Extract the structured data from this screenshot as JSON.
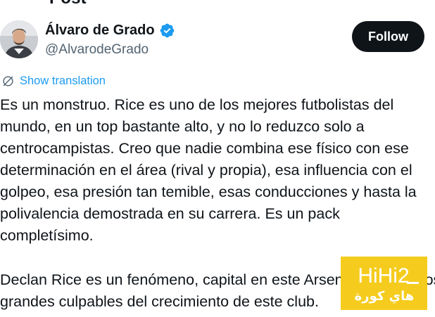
{
  "header": {
    "title": "Post"
  },
  "author": {
    "display_name": "Álvaro de Grado",
    "handle": "@AlvarodeGrado",
    "verified": true,
    "verified_color": "#1d9bf0"
  },
  "actions": {
    "follow_label": "Follow"
  },
  "translation": {
    "label": "Show translation",
    "icon": "globe-icon"
  },
  "tweet": {
    "paragraph1": [
      "Es un monstruo. Rice es uno de los mejores futbolistas del",
      "mundo, en un top bastante alto, y no lo reduzco solo a",
      "centrocampistas. Creo que nadie combina ese físico con ese",
      "determinación en el área (rival y propia), esa influencia con el",
      "golpeo, esa presión tan temible, esas conducciones y hasta la",
      "polivalencia demostrada en su carrera. Es un pack",
      "completísimo."
    ],
    "paragraph2": [
      "Declan Rice es un fenómeno, capital en este Arsenal y uno de los",
      "grandes culpables del crecimiento de este club."
    ]
  },
  "watermark": {
    "text": "HiHi2",
    "subtext": "هاي كورة",
    "background": "#f5cc1d"
  }
}
